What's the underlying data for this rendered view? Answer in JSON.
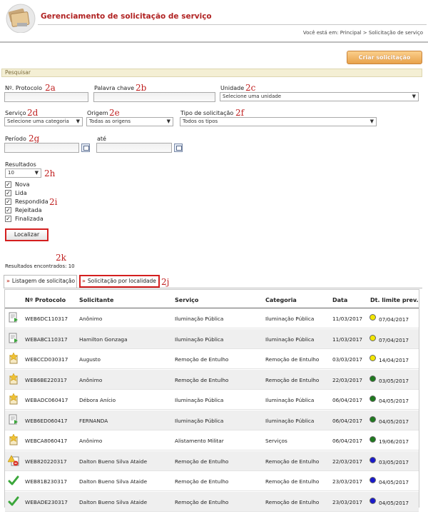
{
  "header": {
    "title": "Gerenciamento de solicitação de serviço",
    "breadcrumb": "Você está em: Principal > Solicitação de serviço",
    "create_button": "Criar solicitação"
  },
  "search": {
    "section_title": "Pesquisar",
    "protocolo_label": "Nº. Protocolo",
    "palavra_label": "Palavra chave",
    "unidade_label": "Unidade",
    "unidade_value": "Selecione uma unidade",
    "servico_label": "Serviço",
    "servico_value": "Selecione uma categoria",
    "origem_label": "Origem",
    "origem_value": "Todas as origens",
    "tipo_label": "Tipo de solicitação",
    "tipo_value": "Todos os tipos",
    "periodo_label": "Período",
    "ate_label": "até",
    "resultados_label": "Resultados",
    "resultados_value": "10",
    "checkboxes": [
      {
        "label": "Nova"
      },
      {
        "label": "Lida"
      },
      {
        "label": "Respondida"
      },
      {
        "label": "Rejeitada"
      },
      {
        "label": "Finalizada"
      }
    ],
    "localizar_button": "Localizar",
    "results_found": "Resultados encontrados: 10"
  },
  "annotations": {
    "a2a": "2a",
    "a2b": "2b",
    "a2c": "2c",
    "a2d": "2d",
    "a2e": "2e",
    "a2f": "2f",
    "a2g": "2g",
    "a2h": "2h",
    "a2i": "2i",
    "a2j": "2j",
    "a2k": "2k"
  },
  "tabs": {
    "listagem": "Listagem de solicitação",
    "localidade": "Solicitação por localidade"
  },
  "table": {
    "headers": {
      "protocolo": "Nº Protocolo",
      "solicitante": "Solicitante",
      "servico": "Serviço",
      "categoria": "Categoria",
      "data": "Data",
      "limite": "Dt. limite prev."
    },
    "colors": {
      "yellow": "#f2e600",
      "green": "#1f7a1f",
      "blue": "#1a1acc"
    },
    "rows": [
      {
        "status_icon": "new-document-icon",
        "protocolo": "WEB6DC110317",
        "solicitante": "Anônimo",
        "servico": "Iluminação Pública",
        "categoria": "Iluminação Pública",
        "data": "11/03/2017",
        "limite": "07/04/2017",
        "dot": "yellow"
      },
      {
        "status_icon": "new-document-icon",
        "protocolo": "WEBABC110317",
        "solicitante": "Hamilton Gonzaga",
        "servico": "Iluminação Pública",
        "categoria": "Iluminação Pública",
        "data": "11/03/2017",
        "limite": "07/04/2017",
        "dot": "yellow"
      },
      {
        "status_icon": "star-document-icon",
        "protocolo": "WEBCCD030317",
        "solicitante": "Augusto",
        "servico": "Remoção de Entulho",
        "categoria": "Remoção de Entulho",
        "data": "03/03/2017",
        "limite": "14/04/2017",
        "dot": "yellow"
      },
      {
        "status_icon": "star-document-icon",
        "protocolo": "WEB6BE220317",
        "solicitante": "Anônimo",
        "servico": "Remoção de Entulho",
        "categoria": "Remoção de Entulho",
        "data": "22/03/2017",
        "limite": "03/05/2017",
        "dot": "green"
      },
      {
        "status_icon": "star-document-icon",
        "protocolo": "WEBADC060417",
        "solicitante": "Débora Anício",
        "servico": "Iluminação Pública",
        "categoria": "Iluminação Pública",
        "data": "06/04/2017",
        "limite": "04/05/2017",
        "dot": "green"
      },
      {
        "status_icon": "new-document-icon",
        "protocolo": "WEB6ED060417",
        "solicitante": "FERNANDA",
        "servico": "Iluminação Pública",
        "categoria": "Iluminação Pública",
        "data": "06/04/2017",
        "limite": "04/05/2017",
        "dot": "green"
      },
      {
        "status_icon": "star-document-icon",
        "protocolo": "WEBCA8060417",
        "solicitante": "Anônimo",
        "servico": "Alistamento Militar",
        "categoria": "Serviços",
        "data": "06/04/2017",
        "limite": "19/06/2017",
        "dot": "green"
      },
      {
        "status_icon": "warning-document-icon",
        "protocolo": "WEB820220317",
        "solicitante": "Dalton Bueno Silva Ataide",
        "servico": "Remoção de Entulho",
        "categoria": "Remoção de Entulho",
        "data": "22/03/2017",
        "limite": "03/05/2017",
        "dot": "blue"
      },
      {
        "status_icon": "checkmark-icon",
        "protocolo": "WEB81B230317",
        "solicitante": "Dalton Bueno Silva Ataide",
        "servico": "Remoção de Entulho",
        "categoria": "Remoção de Entulho",
        "data": "23/03/2017",
        "limite": "04/05/2017",
        "dot": "blue"
      },
      {
        "status_icon": "checkmark-icon",
        "protocolo": "WEBADE230317",
        "solicitante": "Dalton Bueno Silva Ataide",
        "servico": "Remoção de Entulho",
        "categoria": "Remoção de Entulho",
        "data": "23/03/2017",
        "limite": "04/05/2017",
        "dot": "blue"
      }
    ]
  }
}
